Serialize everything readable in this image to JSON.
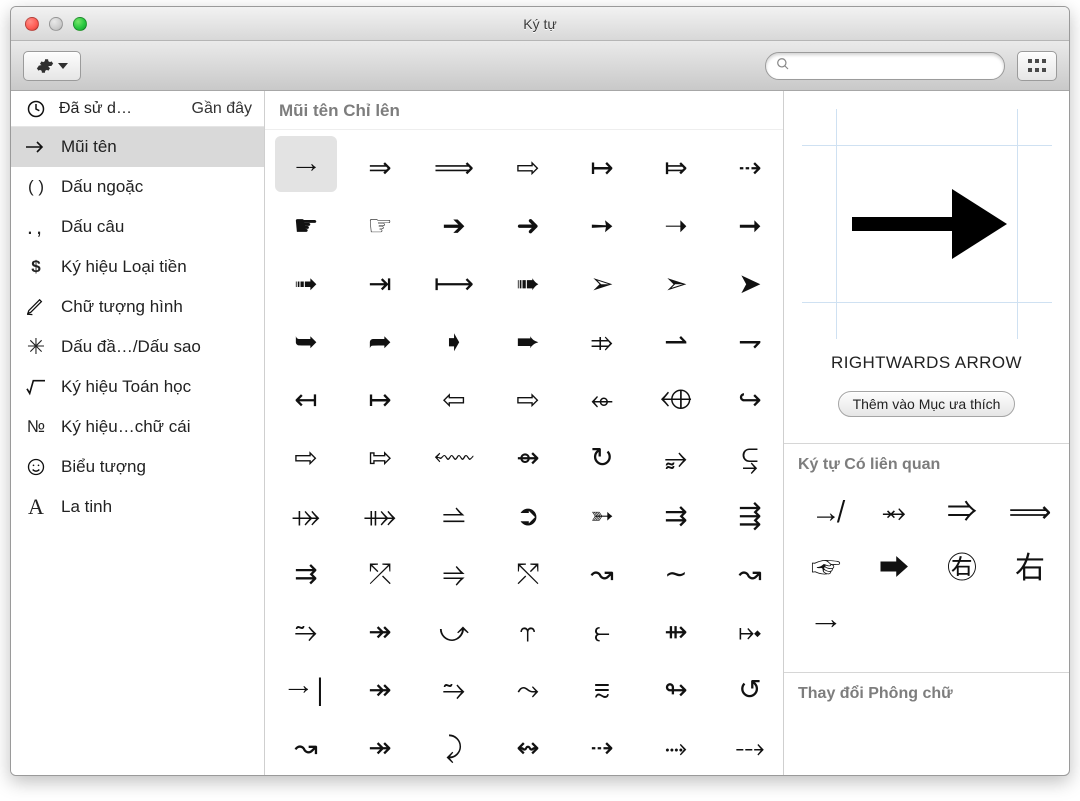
{
  "window": {
    "title": "Ký tự"
  },
  "toolbar": {
    "search_placeholder": ""
  },
  "sidebar": {
    "header": {
      "icon_label": "clock-icon",
      "label": "Đã sử d…",
      "right_label": "Gần đây"
    },
    "items": [
      {
        "icon": "arrow",
        "label": "Mũi tên",
        "selected": true
      },
      {
        "icon": "paren",
        "label": "Dấu ngoặc",
        "selected": false
      },
      {
        "icon": "punct",
        "label": "Dấu câu",
        "selected": false
      },
      {
        "icon": "dollar",
        "label": "Ký hiệu Loại tiền",
        "selected": false
      },
      {
        "icon": "pencil",
        "label": "Chữ tượng hình",
        "selected": false
      },
      {
        "icon": "asterisk",
        "label": "Dấu đầ…/Dấu sao",
        "selected": false
      },
      {
        "icon": "sqrt",
        "label": "Ký hiệu Toán học",
        "selected": false
      },
      {
        "icon": "numero",
        "label": "Ký hiệu…chữ cái",
        "selected": false
      },
      {
        "icon": "smile",
        "label": "Biểu tượng",
        "selected": false
      },
      {
        "icon": "latin",
        "label": "La tinh",
        "selected": false
      }
    ]
  },
  "grid": {
    "heading": "Mũi tên Chỉ lên",
    "selected_index": 0,
    "chars": [
      "→",
      "⇒",
      "⟹",
      "⇨",
      "↦",
      "⤇",
      "⇢",
      "☛",
      "☞",
      "➔",
      "➜",
      "➙",
      "➝",
      "➞",
      "➟",
      "⇥",
      "⟼",
      "➠",
      "➢",
      "➣",
      "➤",
      "➥",
      "➦",
      "➧",
      "➨",
      "⤃",
      "⇀",
      "⇁",
      "↤",
      "↦",
      "⇦",
      "⇨",
      "⬰",
      "⬲",
      "↪",
      "⇨",
      "⇰",
      "⬳",
      "⇴",
      "↻",
      "⥵",
      "⥹",
      "⤀",
      "⤁",
      "⥬",
      "➲",
      "➳",
      "⇉",
      "⇶",
      "⇉",
      "⤱",
      "⥤",
      "⤲",
      "↝",
      "∼",
      "↝",
      "⥲",
      "↠",
      "⤻",
      "⥾",
      "⥼",
      "⇻",
      "⤠",
      "→|",
      "↠",
      "⥲",
      "⤳",
      "⩳",
      "↬",
      "↺",
      "↝",
      "↠",
      "⤸",
      "↭",
      "⇢",
      "⤑",
      "⤏"
    ]
  },
  "detail": {
    "char_name": "RIGHTWARDS ARROW",
    "favorite_button": "Thêm vào Mục ưa thích",
    "related_title": "Ký tự Có liên quan",
    "related_chars": [
      "↛",
      "⥇",
      "⇒",
      "⟹",
      "☞",
      "➡",
      "㊨",
      "右",
      "→"
    ],
    "font_section_title": "Thay đổi Phông chữ"
  }
}
